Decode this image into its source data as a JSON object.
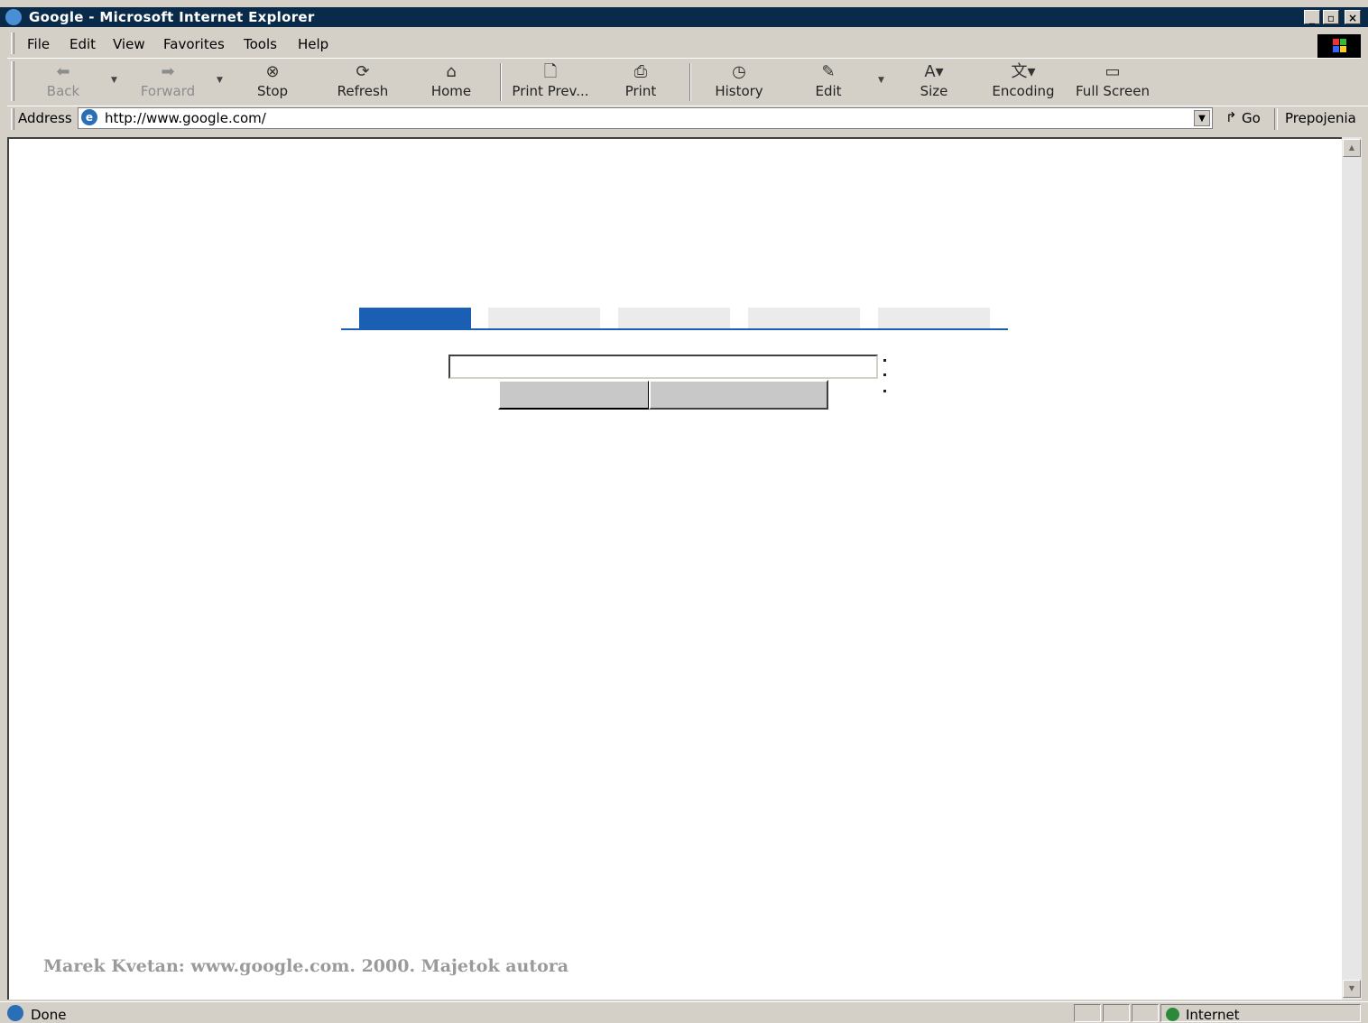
{
  "window": {
    "title": "Google - Microsoft Internet Explorer"
  },
  "menu": [
    "File",
    "Edit",
    "View",
    "Favorites",
    "Tools",
    "Help"
  ],
  "toolbar": [
    {
      "label": "Back",
      "icon": "back-arrow-icon",
      "enabled": false
    },
    {
      "label": "Forward",
      "icon": "forward-arrow-icon",
      "enabled": false
    },
    {
      "label": "Stop",
      "icon": "stop-icon",
      "enabled": true
    },
    {
      "label": "Refresh",
      "icon": "refresh-icon",
      "enabled": true
    },
    {
      "label": "Home",
      "icon": "home-icon",
      "enabled": true
    },
    {
      "label": "Print Prev...",
      "icon": "print-preview-icon",
      "enabled": true
    },
    {
      "label": "Print",
      "icon": "printer-icon",
      "enabled": true
    },
    {
      "label": "History",
      "icon": "history-icon",
      "enabled": true
    },
    {
      "label": "Edit",
      "icon": "edit-icon",
      "enabled": true
    },
    {
      "label": "Size",
      "icon": "text-size-icon",
      "enabled": true
    },
    {
      "label": "Encoding",
      "icon": "encoding-icon",
      "enabled": true
    },
    {
      "label": "Full Screen",
      "icon": "full-screen-icon",
      "enabled": true
    }
  ],
  "address": {
    "label": "Address",
    "url": "http://www.google.com/",
    "go_label": "Go",
    "links_label": "Prepojenia"
  },
  "caption": "Marek Kvetan: www.google.com. 2000. Majetok autora",
  "status": {
    "text": "Done",
    "zone": "Internet"
  },
  "colors": {
    "title_bar": "#0a2a4a",
    "active_tab": "#1a5fb4",
    "inactive_tab": "#ebebeb"
  }
}
